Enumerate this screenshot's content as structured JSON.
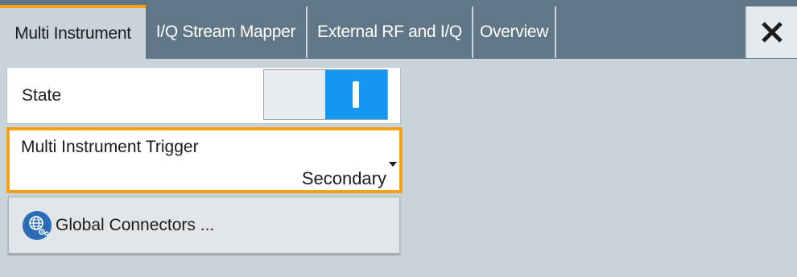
{
  "tabs": [
    {
      "label": "Multi Instrument",
      "active": true
    },
    {
      "label": "I/Q Stream Mapper",
      "active": false
    },
    {
      "label": "External RF and I/Q",
      "active": false
    },
    {
      "label": "Overview",
      "active": false
    }
  ],
  "close_icon": "close-icon",
  "state": {
    "label": "State",
    "value": "on"
  },
  "trigger": {
    "label": "Multi Instrument Trigger",
    "value": "Secondary"
  },
  "global_connectors": {
    "label": "Global Connectors ...",
    "icon": "globe-gear-icon"
  },
  "colors": {
    "accent": "#f5a117",
    "tabbar": "#5f7787",
    "toggle_on": "#1596f0",
    "icon_blue": "#2b6cb6",
    "background": "#c8d3da"
  }
}
